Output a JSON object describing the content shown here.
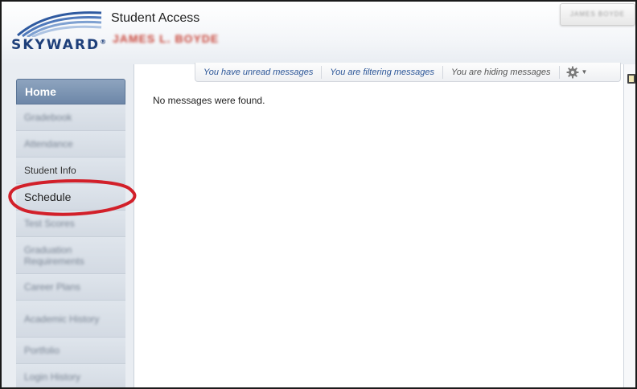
{
  "app": {
    "logo_text": "SKYWARD",
    "logo_mark": "®",
    "title": "Student Access",
    "student_name": "JAMES L. BOYDE",
    "user_name": "JAMES BOYDE"
  },
  "message_bar": {
    "unread": "You have unread messages",
    "filtering": "You are filtering messages",
    "hiding": "You are hiding messages",
    "settings_icon": "gear-icon"
  },
  "main": {
    "empty_message": "No messages were found."
  },
  "sidebar": {
    "items": [
      {
        "label": "Home",
        "state": "active"
      },
      {
        "label": "Gradebook",
        "state": "blurred"
      },
      {
        "label": "Attendance",
        "state": "blurred"
      },
      {
        "label": "Student Info",
        "state": "normal"
      },
      {
        "label": "Schedule",
        "state": "highlighted"
      },
      {
        "label": "Test Scores",
        "state": "blurred"
      },
      {
        "label": "Graduation Requirements",
        "state": "blurred"
      },
      {
        "label": "Career Plans",
        "state": "blurred"
      },
      {
        "label": "Academic History",
        "state": "blurred"
      },
      {
        "label": "Portfolio",
        "state": "blurred"
      },
      {
        "label": "Login History",
        "state": "blurred"
      }
    ]
  },
  "colors": {
    "brand_blue": "#1e3f7a",
    "home_tab": "#7b93b2",
    "annotation_red": "#d2202a",
    "link_blue": "#2b5597"
  }
}
